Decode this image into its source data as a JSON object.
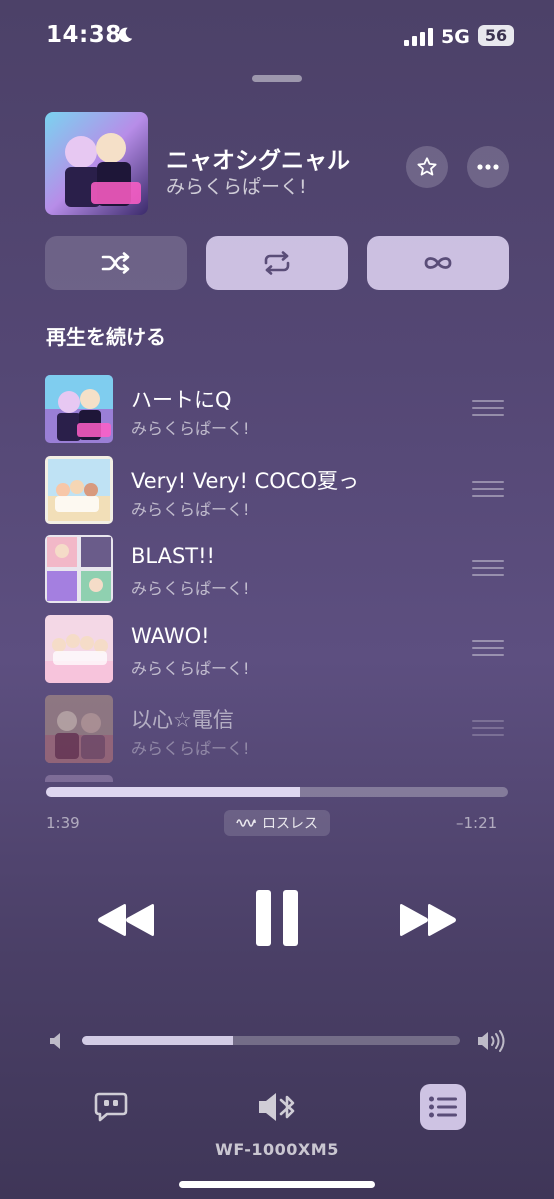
{
  "status_bar": {
    "time": "14:38",
    "network": "5G",
    "battery": "56"
  },
  "now_playing": {
    "title": "ニャオシグニャル",
    "artist": "みらくらぱーく!"
  },
  "section_title": "再生を続ける",
  "queue": [
    {
      "title": "ハートにQ",
      "artist": "みらくらぱーく!"
    },
    {
      "title": "Very! Very! COCO夏っ",
      "artist": "みらくらぱーく!"
    },
    {
      "title": "BLAST!!",
      "artist": "みらくらぱーく!"
    },
    {
      "title": "WAWO!",
      "artist": "みらくらぱーく!"
    },
    {
      "title": "以心☆電信",
      "artist": "みらくらぱーく!"
    }
  ],
  "playback": {
    "elapsed": "1:39",
    "remaining": "–1:21",
    "progress": 0.55,
    "badge": "ロスレス"
  },
  "volume": {
    "level": 0.4
  },
  "output_device": "WF-1000XM5",
  "colors": {
    "accent_button": "#e6dcfa",
    "background": "#544774"
  },
  "icons": [
    "moon-icon",
    "signal-icon",
    "star-icon",
    "more-icon",
    "shuffle-icon",
    "repeat-icon",
    "infinity-icon",
    "lossless-icon",
    "backward-icon",
    "pause-icon",
    "forward-icon",
    "volume-low-icon",
    "volume-high-icon",
    "lyrics-icon",
    "bluetooth-speaker-icon",
    "queue-list-icon"
  ]
}
